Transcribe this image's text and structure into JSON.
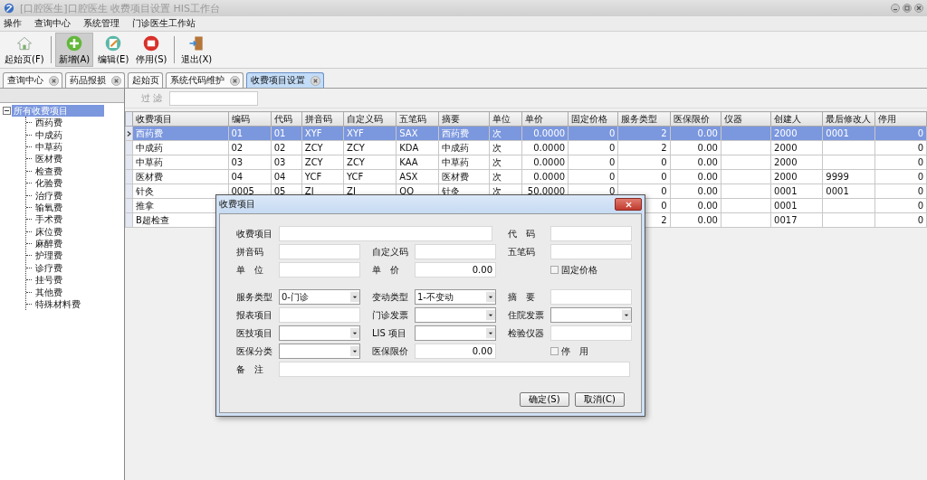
{
  "window": {
    "title": "[口腔医生]口腔医生 收费项目设置   HIS工作台"
  },
  "menu": [
    "操作",
    "查询中心",
    "系统管理",
    "门诊医生工作站"
  ],
  "toolbar": [
    {
      "label": "起始页(F)",
      "kind": "home",
      "pressed": false
    },
    {
      "label": "新增(A)",
      "kind": "add",
      "pressed": true
    },
    {
      "label": "编辑(E)",
      "kind": "edit",
      "pressed": false
    },
    {
      "label": "停用(S)",
      "kind": "stop",
      "pressed": false
    },
    {
      "label": "退出(X)",
      "kind": "exit",
      "pressed": false
    }
  ],
  "tabs": [
    {
      "label": "查询中心",
      "selected": false,
      "closable": true
    },
    {
      "label": "药品报损",
      "selected": false,
      "closable": true
    },
    {
      "label": "起始页",
      "selected": false,
      "closable": false
    },
    {
      "label": "系统代码维护",
      "selected": false,
      "closable": true
    },
    {
      "label": "收费项目设置",
      "selected": true,
      "closable": true
    }
  ],
  "tree": {
    "label": "所有收费项目",
    "selected": true,
    "expanded": true,
    "children": [
      {
        "label": "西药费"
      },
      {
        "label": "中成药"
      },
      {
        "label": "中草药"
      },
      {
        "label": "医材费"
      },
      {
        "label": "检查费"
      },
      {
        "label": "化验费"
      },
      {
        "label": "治疗费"
      },
      {
        "label": "输氧费"
      },
      {
        "label": "手术费"
      },
      {
        "label": "床位费"
      },
      {
        "label": "麻醉费"
      },
      {
        "label": "护理费"
      },
      {
        "label": "诊疗费"
      },
      {
        "label": "挂号费"
      },
      {
        "label": "其他费"
      },
      {
        "label": "特殊材料费"
      }
    ]
  },
  "filter": {
    "label": "过 滤"
  },
  "table": {
    "columns": [
      "收费项目",
      "编码",
      "代码",
      "拼音码",
      "自定义码",
      "五笔码",
      "摘要",
      "单位",
      "单价",
      "固定价格",
      "服务类型",
      "医保限价",
      "仪器",
      "创建人",
      "最后修改人",
      "停用"
    ],
    "rows": [
      {
        "selected": true,
        "cells": [
          "西药费",
          "01",
          "01",
          "XYF",
          "XYF",
          "SAX",
          "西药费",
          "次",
          "0.0000",
          "0",
          "2",
          "0.00",
          "",
          "2000",
          "0001",
          "0"
        ]
      },
      {
        "selected": false,
        "cells": [
          "中成药",
          "02",
          "02",
          "ZCY",
          "ZCY",
          "KDA",
          "中成药",
          "次",
          "0.0000",
          "0",
          "2",
          "0.00",
          "",
          "2000",
          "",
          "0"
        ]
      },
      {
        "selected": false,
        "cells": [
          "中草药",
          "03",
          "03",
          "ZCY",
          "ZCY",
          "KAA",
          "中草药",
          "次",
          "0.0000",
          "0",
          "0",
          "0.00",
          "",
          "2000",
          "",
          "0"
        ]
      },
      {
        "selected": false,
        "cells": [
          "医材费",
          "04",
          "04",
          "YCF",
          "YCF",
          "ASX",
          "医材费",
          "次",
          "0.0000",
          "0",
          "0",
          "0.00",
          "",
          "2000",
          "9999",
          "0"
        ]
      },
      {
        "selected": false,
        "cells": [
          "针灸",
          "0005",
          "05",
          "ZJ",
          "ZJ",
          "QO",
          "针灸",
          "次",
          "50.0000",
          "0",
          "0",
          "0.00",
          "",
          "0001",
          "0001",
          "0"
        ]
      },
      {
        "selected": false,
        "cells": [
          "推拿",
          null,
          null,
          null,
          null,
          null,
          null,
          null,
          null,
          null,
          "0",
          "0.00",
          "",
          "0001",
          "",
          "0"
        ]
      },
      {
        "selected": false,
        "cells": [
          "B超检查",
          null,
          null,
          null,
          null,
          null,
          null,
          null,
          null,
          null,
          "2",
          "0.00",
          "",
          "0017",
          "",
          "0"
        ]
      }
    ]
  },
  "dialog": {
    "title": "收费项目",
    "fields": [
      {
        "label": "收费项目",
        "kind": "text",
        "wide": true
      },
      {
        "label": "代　码",
        "kind": "text"
      },
      {
        "label": "拼音码",
        "kind": "text"
      },
      {
        "label": "自定义码",
        "kind": "text"
      },
      {
        "label": "五笔码",
        "kind": "text"
      },
      {
        "label": "单　位",
        "kind": "text"
      },
      {
        "label": "单　价",
        "kind": "number",
        "value": "0.00"
      },
      {
        "label": "固定价格",
        "kind": "checkbox",
        "checked": false
      },
      {
        "label": "服务类型",
        "kind": "select",
        "value": "0-门诊"
      },
      {
        "label": "变动类型",
        "kind": "select",
        "value": "1-不变动"
      },
      {
        "label": "摘　要",
        "kind": "text"
      },
      {
        "label": "报表项目",
        "kind": "text"
      },
      {
        "label": "门诊发票",
        "kind": "select"
      },
      {
        "label": "住院发票",
        "kind": "select"
      },
      {
        "label": "医技项目",
        "kind": "select"
      },
      {
        "label": "LIS 项目",
        "kind": "select"
      },
      {
        "label": "检验仪器",
        "kind": "text"
      },
      {
        "label": "医保分类",
        "kind": "select"
      },
      {
        "label": "医保限价",
        "kind": "number",
        "value": "0.00"
      },
      {
        "label": "停　用",
        "kind": "checkbox",
        "checked": false
      },
      {
        "label": "备　注",
        "kind": "text",
        "full": true
      }
    ],
    "buttons": [
      "确定(S)",
      "取消(C)"
    ]
  }
}
